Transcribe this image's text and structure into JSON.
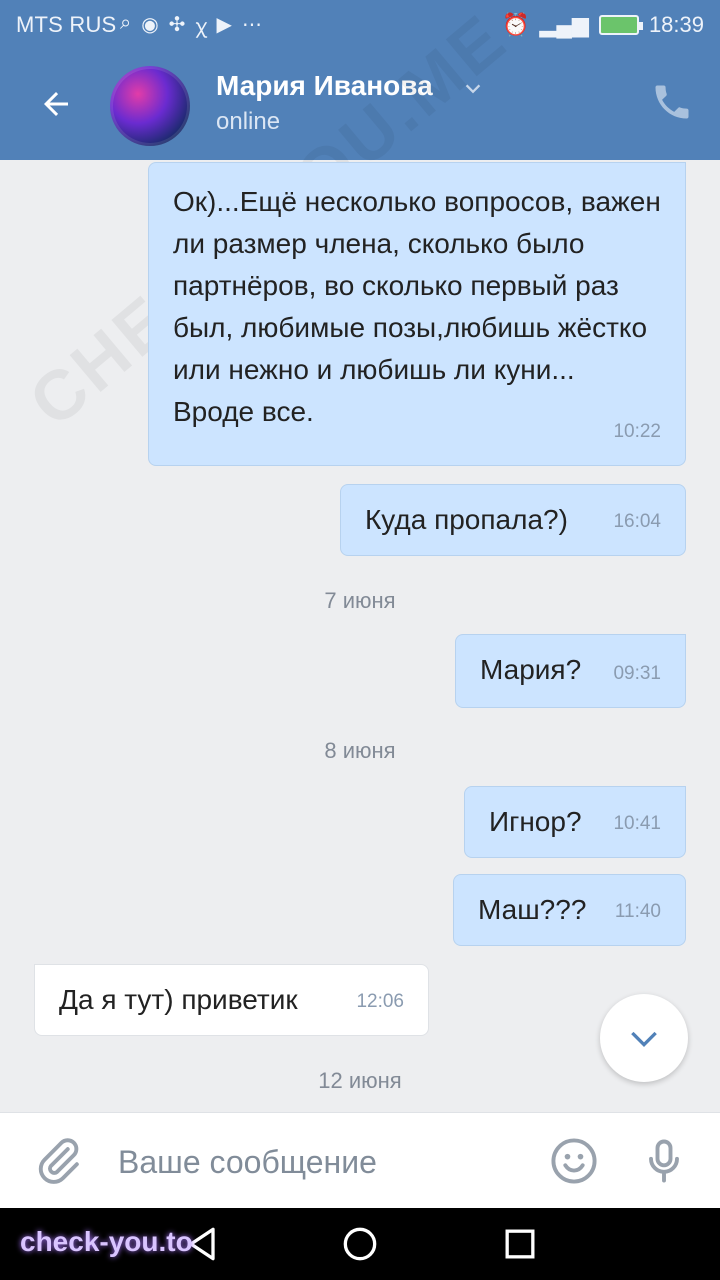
{
  "status_bar": {
    "carrier": "MTS RUS",
    "time": "18:39"
  },
  "header": {
    "contact_name": "Мария Иванова",
    "status": "online",
    "colors": {
      "bar": "#5181b8"
    }
  },
  "messages": [
    {
      "direction": "outgoing",
      "text": "Ок)...Ещё несколько вопросов, важен ли размер члена, сколько было партнёров, во сколько первый раз был, любимые позы,любишь жёстко или нежно и любишь ли куни... Вроде все.",
      "time": "10:22"
    },
    {
      "direction": "outgoing",
      "text": "Куда пропала?)",
      "time": "16:04"
    },
    {
      "type": "date",
      "text": "7 июня"
    },
    {
      "direction": "outgoing",
      "text": "Мария?",
      "time": "09:31"
    },
    {
      "type": "date",
      "text": "8 июня"
    },
    {
      "direction": "outgoing",
      "text": "Игнор?",
      "time": "10:41"
    },
    {
      "direction": "outgoing",
      "text": "Маш???",
      "time": "11:40"
    },
    {
      "direction": "incoming",
      "text": "Да я тут) приветик",
      "time": "12:06"
    },
    {
      "type": "date",
      "text": "12 июня"
    }
  ],
  "composer": {
    "placeholder": "Ваше сообщение"
  },
  "watermark": {
    "bottom": "check-you.to",
    "diagonal": "CHECK-YOU.ME"
  },
  "icons": {
    "back": "arrow-left-icon",
    "call": "phone-icon",
    "attach": "paperclip-icon",
    "emoji": "smile-icon",
    "mic": "mic-icon",
    "scroll_down": "chevron-down-icon"
  }
}
